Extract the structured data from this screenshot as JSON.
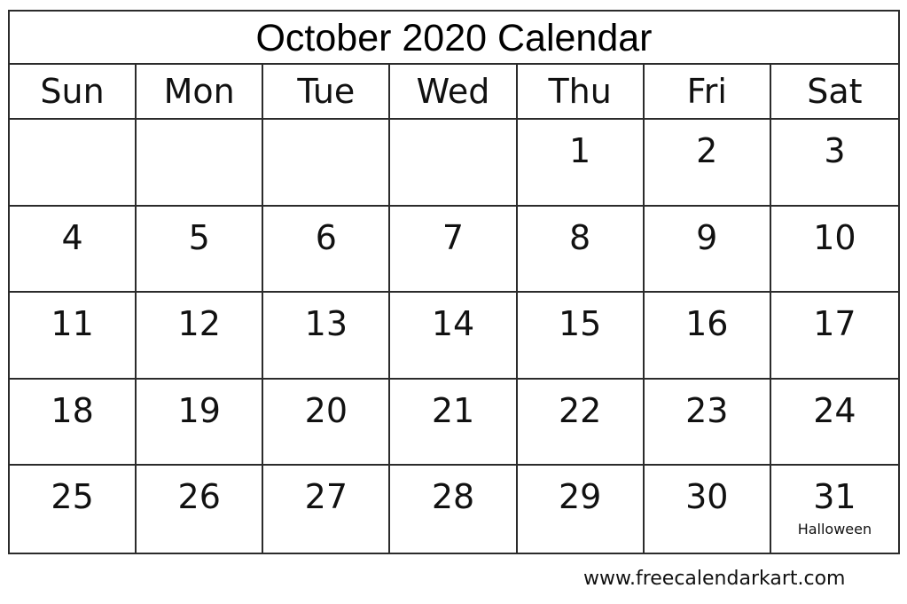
{
  "calendar": {
    "title": "October 2020 Calendar",
    "weekdays": [
      "Sun",
      "Mon",
      "Tue",
      "Wed",
      "Thu",
      "Fri",
      "Sat"
    ],
    "weeks": [
      [
        {
          "day": ""
        },
        {
          "day": ""
        },
        {
          "day": ""
        },
        {
          "day": ""
        },
        {
          "day": "1"
        },
        {
          "day": "2"
        },
        {
          "day": "3"
        }
      ],
      [
        {
          "day": "4"
        },
        {
          "day": "5"
        },
        {
          "day": "6"
        },
        {
          "day": "7"
        },
        {
          "day": "8"
        },
        {
          "day": "9"
        },
        {
          "day": "10"
        }
      ],
      [
        {
          "day": "11"
        },
        {
          "day": "12"
        },
        {
          "day": "13"
        },
        {
          "day": "14"
        },
        {
          "day": "15"
        },
        {
          "day": "16"
        },
        {
          "day": "17"
        }
      ],
      [
        {
          "day": "18"
        },
        {
          "day": "19"
        },
        {
          "day": "20"
        },
        {
          "day": "21"
        },
        {
          "day": "22"
        },
        {
          "day": "23"
        },
        {
          "day": "24"
        }
      ],
      [
        {
          "day": "25"
        },
        {
          "day": "26"
        },
        {
          "day": "27"
        },
        {
          "day": "28"
        },
        {
          "day": "29"
        },
        {
          "day": "30"
        },
        {
          "day": "31",
          "note": "Halloween"
        }
      ]
    ]
  },
  "footer": {
    "website": "www.freecalendarkart.com"
  }
}
